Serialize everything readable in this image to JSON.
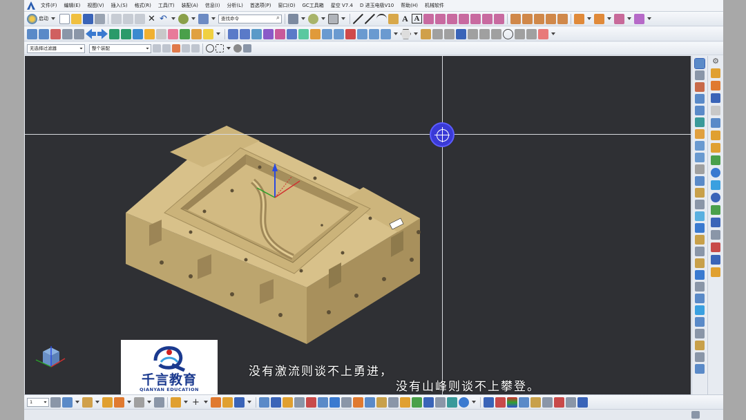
{
  "menu": [
    "文件(F)",
    "编辑(E)",
    "视图(V)",
    "插入(S)",
    "格式(R)",
    "工具(T)",
    "装配(A)",
    "信息(I)",
    "分析(L)",
    "首选项(P)",
    "窗口(O)",
    "GC工具箱",
    "星空 V7.4",
    "D 进玉电极V10",
    "帮助(H)",
    "机械软件"
  ],
  "toolbar1": {
    "start_label": "启动",
    "command_search_placeholder": "查找命令"
  },
  "toolbar3": {
    "filter_select": "无选择过滤器",
    "scope_select": "整个装配"
  },
  "bottom_bar": {
    "layer_select": "1"
  },
  "logo": {
    "name_cn": "千言教育",
    "name_en": "QIANYAN EDUCATION"
  },
  "subtitles": [
    "没有激流则谈不上勇进，",
    "没有山峰则谈不上攀登。"
  ],
  "colors": {
    "viewport_bg": "#2f3034",
    "model_face": "#d6be86",
    "model_side": "#b9a06a",
    "logo_blue": "#1b3a8f",
    "cursor_blue": "#3a3ad6"
  }
}
